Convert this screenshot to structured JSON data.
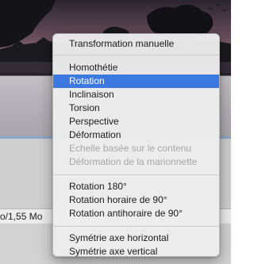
{
  "status_bar": {
    "text": "o/1,55 Mo"
  },
  "context_menu": {
    "sections": [
      {
        "items": [
          {
            "label": "Transformation manuelle",
            "state": "enabled"
          }
        ]
      },
      {
        "items": [
          {
            "label": "Homothétie",
            "state": "enabled"
          },
          {
            "label": "Rotation",
            "state": "selected"
          },
          {
            "label": "Inclinaison",
            "state": "enabled"
          },
          {
            "label": "Torsion",
            "state": "enabled"
          },
          {
            "label": "Perspective",
            "state": "enabled"
          },
          {
            "label": "Déformation",
            "state": "enabled"
          },
          {
            "label": "Echelle basée sur le contenu",
            "state": "disabled"
          },
          {
            "label": "Déformation de la marionnette",
            "state": "disabled"
          }
        ]
      },
      {
        "items": [
          {
            "label": "Rotation 180°",
            "state": "enabled"
          },
          {
            "label": "Rotation horaire de 90°",
            "state": "enabled"
          },
          {
            "label": "Rotation antihoraire de 90°",
            "state": "enabled"
          }
        ]
      },
      {
        "items": [
          {
            "label": "Symétrie axe horizontal",
            "state": "enabled"
          },
          {
            "label": "Symétrie axe vertical",
            "state": "enabled"
          }
        ]
      }
    ]
  },
  "colors": {
    "selection_highlight": "#3b78e0",
    "disabled_text": "#a7a7a7"
  }
}
